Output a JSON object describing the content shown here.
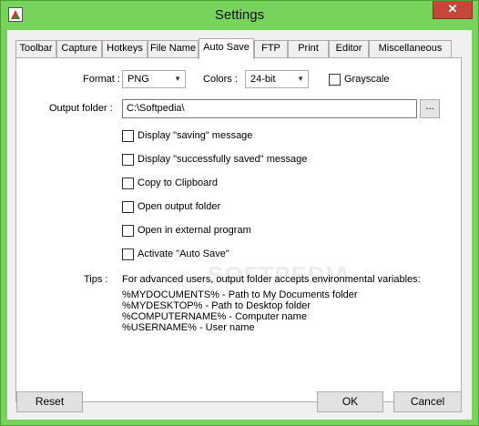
{
  "window": {
    "title": "Settings",
    "close_glyph": "✕"
  },
  "tabs": [
    "Toolbar",
    "Capture",
    "Hotkeys",
    "File Name",
    "Auto Save",
    "FTP",
    "Print",
    "Editor",
    "Miscellaneous"
  ],
  "active_tab": "Auto Save",
  "format": {
    "label": "Format :",
    "value": "PNG"
  },
  "colors": {
    "label": "Colors :",
    "value": "24-bit"
  },
  "grayscale": {
    "label": "Grayscale",
    "checked": false
  },
  "output_folder": {
    "label": "Output folder :",
    "value": "C:\\Softpedia\\",
    "browse_label": "..."
  },
  "options": [
    {
      "label": "Display \"saving\" message",
      "checked": false
    },
    {
      "label": "Display \"successfully saved\" message",
      "checked": false
    },
    {
      "label": "Copy to Clipboard",
      "checked": false
    },
    {
      "label": "Open output folder",
      "checked": false
    },
    {
      "label": "Open in external program",
      "checked": false
    },
    {
      "label": "Activate \"Auto Save\"",
      "checked": false
    }
  ],
  "tips": {
    "label": "Tips :",
    "intro": "For advanced users, output folder accepts environmental variables:",
    "lines": [
      "%MYDOCUMENTS% - Path to My Documents folder",
      "%MYDESKTOP% - Path to Desktop folder",
      "%COMPUTERNAME% - Computer name",
      "%USERNAME% - User name"
    ]
  },
  "watermark": "SOFTPEDIA",
  "buttons": {
    "reset": "Reset",
    "ok": "OK",
    "cancel": "Cancel"
  },
  "colors_theme": {
    "titlebar": "#78d35c",
    "close": "#c7463a",
    "dialog_bg": "#f0f0f0"
  }
}
